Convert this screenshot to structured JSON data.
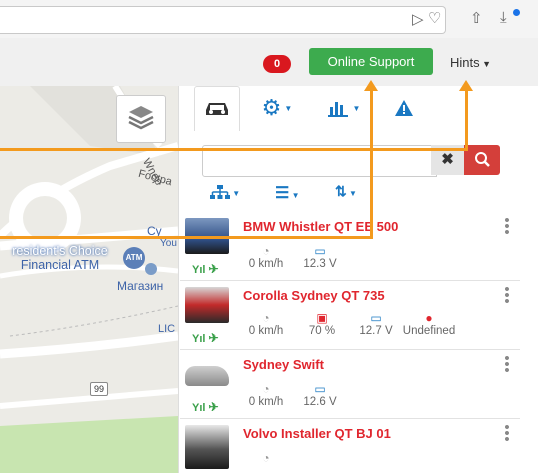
{
  "browser": {
    "icons": [
      "send-icon",
      "heart-icon",
      "share-icon",
      "download-icon"
    ],
    "notify_dot_color": "#1a73e8"
  },
  "header": {
    "badge_count": "0",
    "online_support_label": "Online Support",
    "hints_label": "Hints",
    "colors": {
      "badge": "#d9181f",
      "support": "#3dab4e"
    }
  },
  "map": {
    "labels": {
      "footpath": "Footpa",
      "road": "Wnep",
      "poi_line1": "resident's Choice",
      "poi_line2": "Financial ATM",
      "poi_abbr": "ATM",
      "cy": "Cy",
      "you": "You",
      "shop": "Магазин",
      "lic": "LIC",
      "route": "99"
    }
  },
  "panel": {
    "tabs": [
      "car-icon",
      "gear-icon",
      "bar-chart-icon",
      "warning-icon"
    ],
    "search": {
      "value": "",
      "placeholder": ""
    },
    "tools": [
      "hierarchy-icon",
      "list-icon",
      "sort-icon"
    ]
  },
  "vehicles": [
    {
      "name": "BMW Whistler QT EE 500",
      "speed": "0 km/h",
      "voltage": "12.3 V",
      "fuel": "",
      "driver": ""
    },
    {
      "name": "Corolla Sydney QT 735",
      "speed": "0 km/h",
      "voltage": "12.7 V",
      "fuel": "70 %",
      "driver": "Undefined"
    },
    {
      "name": "Sydney Swift",
      "speed": "0 km/h",
      "voltage": "12.6 V",
      "fuel": "",
      "driver": ""
    },
    {
      "name": "Volvo Installer QT BJ 01",
      "speed": "",
      "voltage": "",
      "fuel": "",
      "driver": ""
    }
  ],
  "accent": {
    "link_blue": "#1a78c2",
    "alert_red": "#e0262e",
    "annotation_orange": "#f39a1e"
  }
}
